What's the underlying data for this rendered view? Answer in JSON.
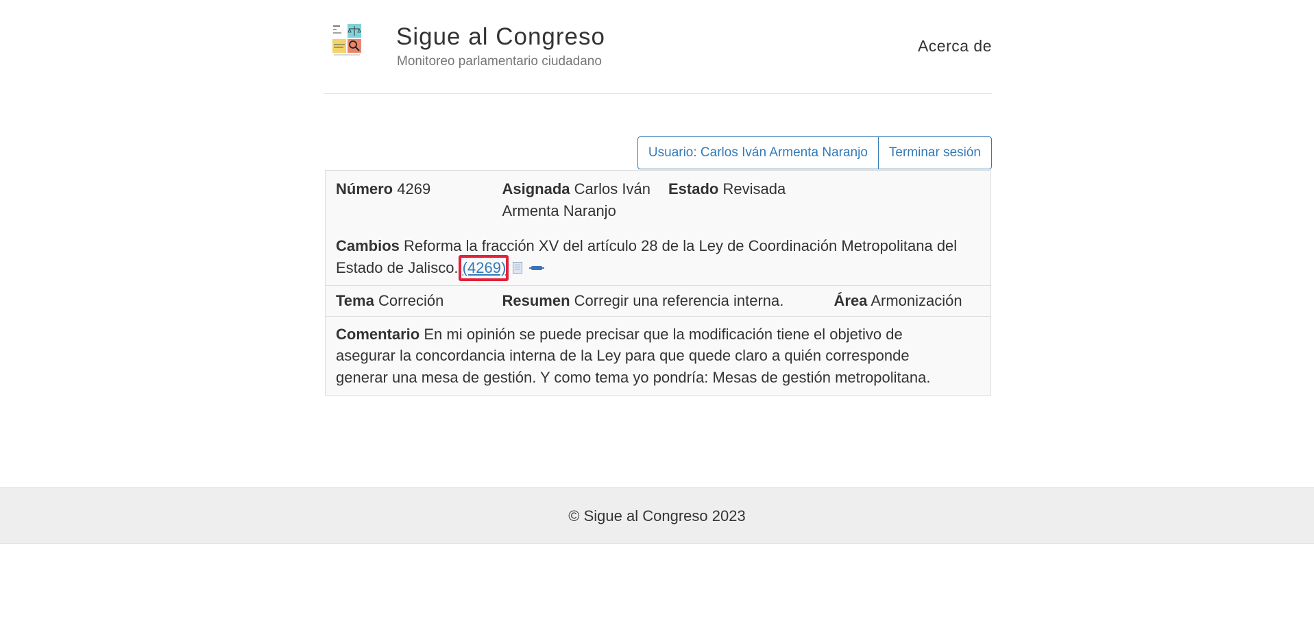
{
  "header": {
    "title": "Sigue al Congreso",
    "subtitle": "Monitoreo parlamentario ciudadano",
    "about_link": "Acerca de",
    "logo_icon": "sigue-al-congreso-logo"
  },
  "session": {
    "user_button": "Usuario: Carlos Iván Armenta Naranjo",
    "logout_button": "Terminar sesión"
  },
  "record": {
    "number_label": "Número",
    "number_value": "4269",
    "assigned_label": "Asignada",
    "assigned_value": "Carlos Iván Armenta Naranjo",
    "status_label": "Estado",
    "status_value": "Revisada",
    "changes_label": "Cambios",
    "changes_text": "Reforma la fracción XV del artículo 28 de la Ley de Coordinación Metropolitana del Estado de Jalisco.",
    "changes_link": "(4269)",
    "document_icon": "document-icon",
    "diff_icon": "diff-icon",
    "topic_label": "Tema",
    "topic_value": "Correción",
    "summary_label": "Resumen",
    "summary_value": "Corregir una referencia interna.",
    "area_label": "Área",
    "area_value": "Armonización",
    "comment_label": "Comentario",
    "comment_value": "En mi opinión se puede precisar que la modificación tiene el objetivo de asegurar la concordancia interna de la Ley para que quede claro a quién corresponde generar una mesa de gestión. Y como tema yo pondría: Mesas de gestión metropolitana."
  },
  "footer": {
    "copyright": "© Sigue al Congreso 2023"
  },
  "colors": {
    "link": "#337ab7",
    "highlight": "#e3213a",
    "table_bg": "#f9f9f9",
    "footer_bg": "#eeeeee"
  }
}
